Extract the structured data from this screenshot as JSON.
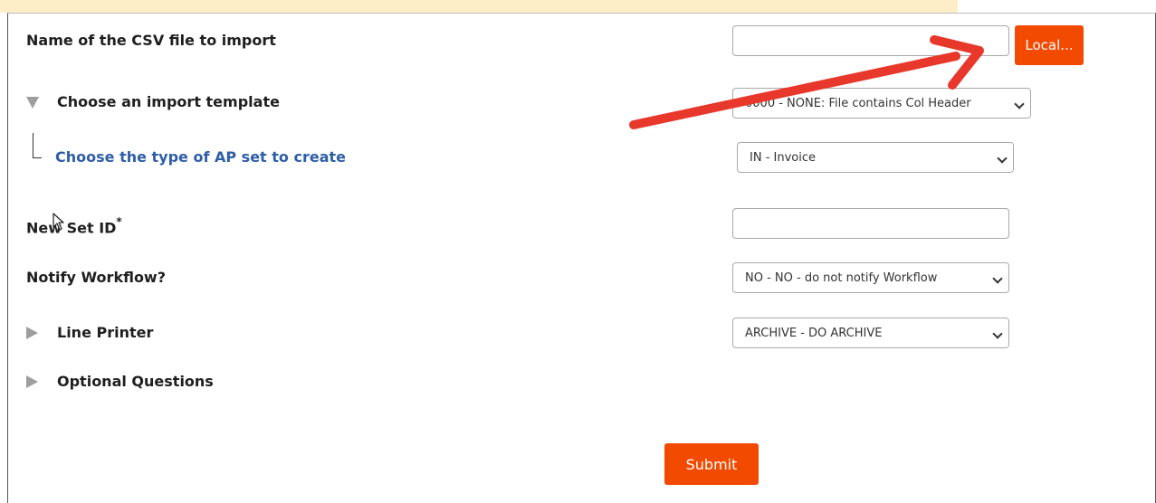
{
  "form": {
    "csv_file": {
      "label": "Name of the CSV file to import",
      "value": "",
      "button_label": "Local..."
    },
    "import_template": {
      "label": "Choose an import template",
      "selected": "0000 - NONE: File contains Col Header"
    },
    "ap_set_type": {
      "label": "Choose the type of AP set to create",
      "selected": "IN - Invoice"
    },
    "new_set_id": {
      "label": "New Set ID",
      "required_mark": "*",
      "value": ""
    },
    "notify_workflow": {
      "label": "Notify Workflow?",
      "selected": "NO - NO - do not notify Workflow"
    },
    "line_printer": {
      "label": "Line Printer",
      "selected": "ARCHIVE - DO ARCHIVE"
    },
    "optional_questions": {
      "label": "Optional Questions"
    },
    "submit_label": "Submit"
  },
  "icons": {
    "expanded": "triangle-down-icon",
    "collapsed": "triangle-right-icon",
    "dropdown": "chevron-down-icon",
    "annotation": "red-arrow-annotation",
    "cursor": "mouse-pointer-icon"
  },
  "colors": {
    "accent": "#f24a00",
    "annotation_arrow": "#e8372b",
    "link_label": "#2e5ea8",
    "banner": "#fdeec8"
  }
}
